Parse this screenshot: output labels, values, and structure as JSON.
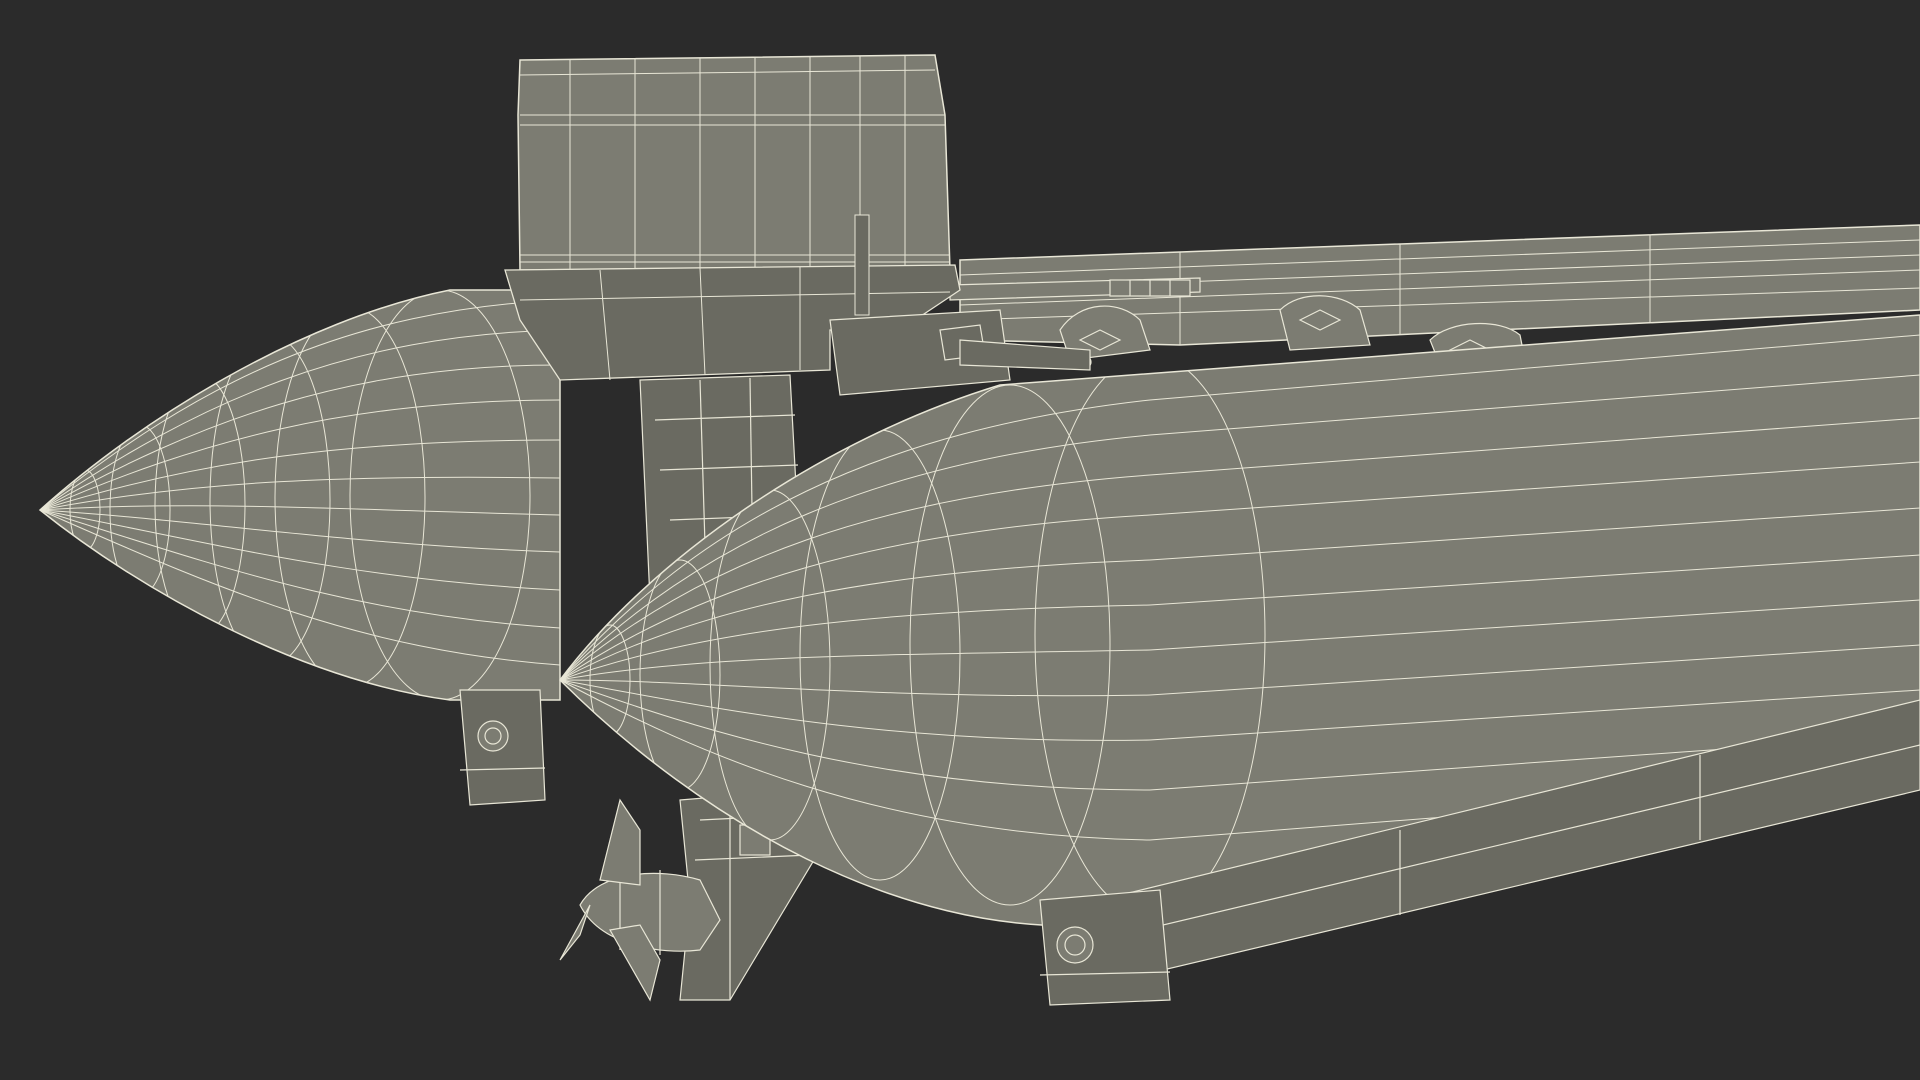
{
  "scene": {
    "background_color": "#2b2b2b",
    "mesh_fill_color": "#7c7c72",
    "mesh_fill_dark_color": "#6a6a61",
    "mesh_fill_light_color": "#86867b",
    "wire_color": "#e8e6d6"
  }
}
